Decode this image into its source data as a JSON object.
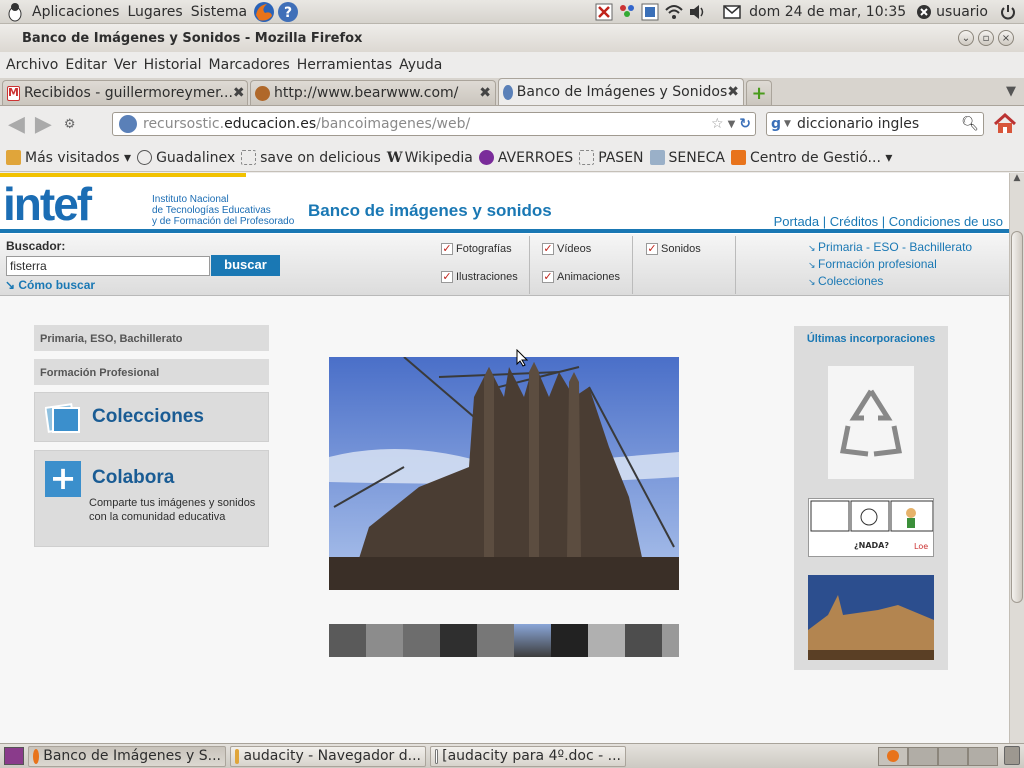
{
  "panel": {
    "menus": [
      "Aplicaciones",
      "Lugares",
      "Sistema"
    ],
    "datetime": "dom 24 de mar, 10:35",
    "user": "usuario"
  },
  "window": {
    "title": "Banco de Imágenes y Sonidos - Mozilla Firefox"
  },
  "menubar": [
    "Archivo",
    "Editar",
    "Ver",
    "Historial",
    "Marcadores",
    "Herramientas",
    "Ayuda"
  ],
  "tabs": [
    {
      "label": "Recibidos - guillermoreymer..."
    },
    {
      "label": "http://www.bearwww.com/"
    },
    {
      "label": "Banco de Imágenes y Sonidos"
    }
  ],
  "navbar": {
    "url_prefix": "recursostic.",
    "url_domain": "educacion.es",
    "url_path": "/bancoimagenes/web/",
    "search_value": "diccionario ingles"
  },
  "bookmarks": [
    "Más visitados",
    "Guadalinex",
    "save on delicious",
    "Wikipedia",
    "AVERROES",
    "PASEN",
    "SENECA",
    "Centro de Gestió..."
  ],
  "site": {
    "logo": "intef",
    "institute": [
      "Instituto Nacional",
      "de Tecnologías Educativas",
      "y de Formación del Profesorado"
    ],
    "banner_title": "Banco de imágenes y sonidos",
    "top_links": [
      "Portada",
      "Créditos",
      "Condiciones de uso"
    ],
    "search_label": "Buscador:",
    "search_value": "fisterra",
    "search_button": "buscar",
    "how_search": "Cómo buscar",
    "filters": [
      "Fotografías",
      "Ilustraciones",
      "Vídeos",
      "Animaciones",
      "Sonidos"
    ],
    "right_links": [
      "Primaria - ESO - Bachillerato",
      "Formación profesional",
      "Colecciones"
    ],
    "left_nav": [
      "Primaria, ESO, Bachillerato",
      "Formación Profesional"
    ],
    "colecciones": "Colecciones",
    "colabora_title": "Colabora",
    "colabora_text": "Comparte tus imágenes y sonidos con la comunidad educativa",
    "latest_title": "Últimas incorporaciones",
    "comic_text": "¿NADA?"
  },
  "taskbar": [
    {
      "label": "Banco de Imágenes y S..."
    },
    {
      "label": "audacity - Navegador d..."
    },
    {
      "label": "[audacity para 4º.doc - ..."
    }
  ],
  "colors": {
    "brand_blue": "#1a78b4",
    "link_blue": "#1a78b4",
    "check_red": "#c0231b"
  }
}
